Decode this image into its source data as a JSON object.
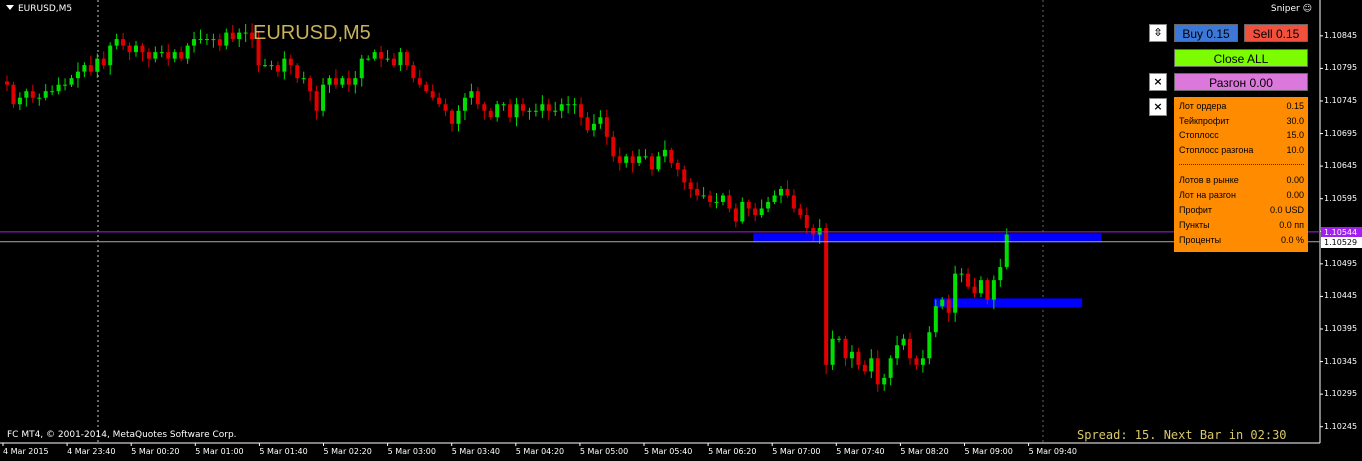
{
  "header": {
    "symbol": "EURUSD,M5",
    "big_title": "EURUSD,M5",
    "indicator": "Sniper",
    "indicator_icon": "smiley-icon"
  },
  "footer": {
    "copyright": "FC MT4, © 2001-2014, MetaQuotes Software Corp.",
    "spread": "Spread: 15. Next Bar in 02:30"
  },
  "buttons": {
    "buy": "Buy 0.15",
    "sell": "Sell 0.15",
    "close_all": "Close ALL",
    "razgon": "Разгон 0.00",
    "up_icon": "⇳",
    "close1": "×",
    "close2": "×"
  },
  "colors": {
    "buy": "#3c78d8",
    "sell": "#f0503c",
    "close_all": "#7cfc00",
    "razgon": "#dc78dc",
    "panel": "#ff8c00",
    "bull": "#00e000",
    "bear": "#e00000",
    "zone": "#0000ff"
  },
  "panel": {
    "rows": [
      {
        "label": "Лот ордера",
        "value": "0.15"
      },
      {
        "label": "Тейкпрофит",
        "value": "30.0"
      },
      {
        "label": "Стоплосс",
        "value": "15.0"
      },
      {
        "label": "Стоплосс разгона",
        "value": "10.0"
      },
      {
        "label": "Лотов в рынке",
        "value": "0.00"
      },
      {
        "label": "Лот на разгон",
        "value": "0.00"
      },
      {
        "label": "Профит",
        "value": "0.0 USD"
      },
      {
        "label": "Пункты",
        "value": "0.0 пп"
      },
      {
        "label": "Проценты",
        "value": "0.0 %"
      }
    ]
  },
  "chart_data": {
    "type": "candlestick",
    "ylim": [
      1.1022,
      1.109
    ],
    "y_ticks": [
      "1.10845",
      "1.10795",
      "1.10745",
      "1.10695",
      "1.10645",
      "1.10595",
      "1.10545",
      "1.10495",
      "1.10445",
      "1.10395",
      "1.10345",
      "1.10295",
      "1.10245"
    ],
    "x_ticks": [
      "4 Mar 2015",
      "4 Mar 23:40",
      "5 Mar 00:20",
      "5 Mar 01:00",
      "5 Mar 01:40",
      "5 Mar 02:20",
      "5 Mar 03:00",
      "5 Mar 03:40",
      "5 Mar 04:20",
      "5 Mar 05:00",
      "5 Mar 05:40",
      "5 Mar 06:20",
      "5 Mar 07:00",
      "5 Mar 07:40",
      "5 Mar 08:20",
      "5 Mar 09:00",
      "5 Mar 09:40"
    ],
    "bid": "1.10529",
    "ask": "1.10544",
    "zones": [
      {
        "y_top": 1.10542,
        "y_bottom": 1.10528,
        "from_bar": 116,
        "to_bar": 170
      },
      {
        "y_top": 1.10442,
        "y_bottom": 1.10428,
        "from_bar": 144,
        "to_bar": 167
      }
    ],
    "closes": [
      1.1077,
      1.1074,
      1.1075,
      1.1076,
      1.1075,
      1.1075,
      1.1076,
      1.1076,
      1.1077,
      1.1077,
      1.1078,
      1.1079,
      1.108,
      1.1079,
      1.1081,
      1.108,
      1.1083,
      1.1084,
      1.1083,
      1.1082,
      1.1083,
      1.1082,
      1.1081,
      1.1082,
      1.1082,
      1.1081,
      1.1082,
      1.1081,
      1.1083,
      1.1084,
      1.1084,
      1.1084,
      1.1084,
      1.1083,
      1.1085,
      1.1084,
      1.1085,
      1.1085,
      1.1084,
      1.108,
      1.108,
      1.108,
      1.1079,
      1.1081,
      1.108,
      1.1078,
      1.1078,
      1.1076,
      1.1073,
      1.1077,
      1.1078,
      1.1077,
      1.1078,
      1.1077,
      1.1078,
      1.1081,
      1.1081,
      1.1082,
      1.1081,
      1.1081,
      1.108,
      1.1082,
      1.108,
      1.1078,
      1.1077,
      1.1076,
      1.1075,
      1.1074,
      1.1073,
      1.1071,
      1.1073,
      1.1075,
      1.1076,
      1.1074,
      1.1073,
      1.1072,
      1.1074,
      1.1074,
      1.1072,
      1.1074,
      1.1073,
      1.1073,
      1.1073,
      1.1074,
      1.1073,
      1.1073,
      1.1074,
      1.1074,
      1.1074,
      1.1072,
      1.107,
      1.1071,
      1.1072,
      1.1069,
      1.1066,
      1.1065,
      1.1066,
      1.1065,
      1.1066,
      1.1066,
      1.1064,
      1.1066,
      1.1067,
      1.1065,
      1.1064,
      1.1062,
      1.1061,
      1.106,
      1.106,
      1.1059,
      1.1059,
      1.106,
      1.1058,
      1.1056,
      1.1059,
      1.1058,
      1.1057,
      1.1058,
      1.1059,
      1.106,
      1.1061,
      1.106,
      1.1058,
      1.1057,
      1.1055,
      1.1054,
      1.1055,
      1.1034,
      1.1038,
      1.1038,
      1.1035,
      1.1036,
      1.1034,
      1.1033,
      1.1035,
      1.1031,
      1.1032,
      1.1035,
      1.1037,
      1.1038,
      1.1035,
      1.1034,
      1.1035,
      1.1039,
      1.1043,
      1.1044,
      1.1042,
      1.1048,
      1.1048,
      1.1046,
      1.1045,
      1.1047,
      1.1044,
      1.1047,
      1.1049,
      1.1054
    ]
  }
}
